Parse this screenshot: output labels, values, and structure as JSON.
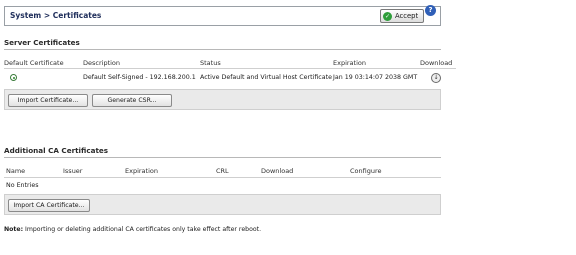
{
  "header": {
    "breadcrumb": "System > Certificates",
    "accept_label": "Accept",
    "help_icon": "help-icon"
  },
  "server_certificates": {
    "title": "Server Certificates",
    "columns": [
      "Default Certificate",
      "Description",
      "Status",
      "Expiration",
      "Download"
    ],
    "rows": [
      {
        "default_selected": true,
        "description": "Default Self-Signed - 192.168.200.1",
        "status": "Active Default and Virtual Host Certificate",
        "expiration": "Jan 19 03:14:07 2038 GMT",
        "download_icon": "download-icon"
      }
    ],
    "buttons": {
      "import": "Import Certificate...",
      "generate_csr": "Generate CSR..."
    }
  },
  "additional_ca": {
    "title": "Additional CA Certificates",
    "columns": [
      "Name",
      "Issuer",
      "Expiration",
      "CRL",
      "Download",
      "Configure"
    ],
    "empty_text": "No Entries",
    "buttons": {
      "import": "Import CA Certificate..."
    }
  },
  "note": {
    "label": "Note:",
    "text": " Importing or deleting additional CA certificates only take effect after reboot."
  }
}
